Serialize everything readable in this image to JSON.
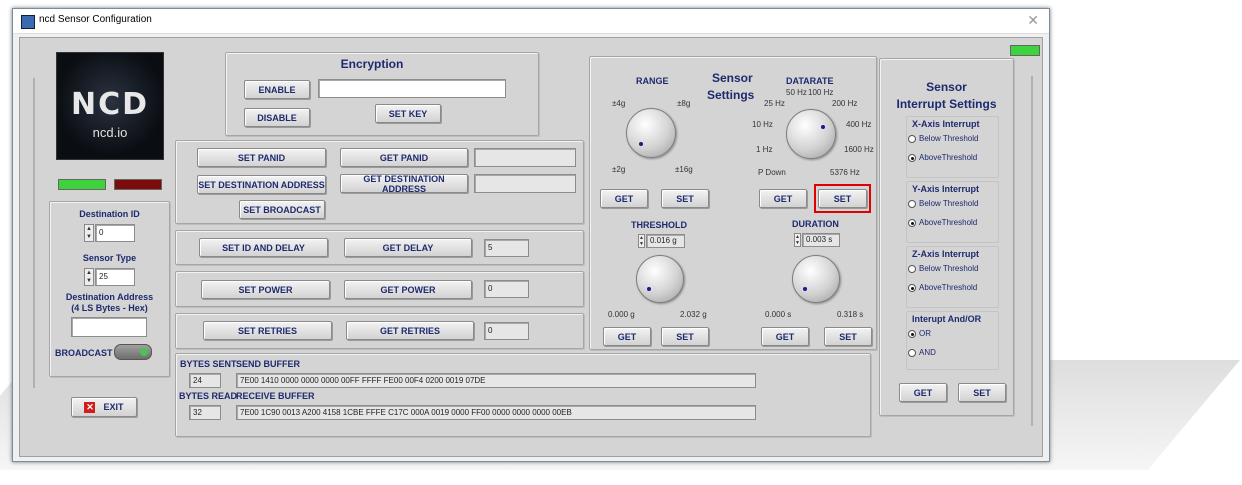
{
  "window": {
    "title": "ncd Sensor Configuration",
    "close_glyph": "✕"
  },
  "logo": {
    "big": "NCD",
    "site": "ncd.io"
  },
  "left": {
    "destination_id_label": "Destination ID",
    "destination_id_value": "0",
    "sensor_type_label": "Sensor Type",
    "sensor_type_value": "25",
    "dest_address_label_1": "Destination Address",
    "dest_address_label_2": "(4 LS Bytes - Hex)",
    "dest_address_value": "",
    "broadcast_label": "BROADCAST",
    "exit_label": "EXIT"
  },
  "encryption": {
    "title": "Encryption",
    "enable": "ENABLE",
    "disable": "DISABLE",
    "set_key": "SET KEY",
    "key_value": ""
  },
  "panid": {
    "set_panid": "SET PANID",
    "get_panid": "GET PANID",
    "panid_value": "",
    "set_dest": "SET DESTINATION ADDRESS",
    "get_dest": "GET DESTINATION ADDRESS",
    "dest_value": "",
    "set_broadcast": "SET BROADCAST"
  },
  "delay": {
    "set": "SET ID AND DELAY",
    "get": "GET DELAY",
    "value": "5"
  },
  "power": {
    "set": "SET POWER",
    "get": "GET POWER",
    "value": "0"
  },
  "retries": {
    "set": "SET RETRIES",
    "get": "GET RETRIES",
    "value": "0"
  },
  "buffers": {
    "bytes_sent_label": "BYTES SENT",
    "bytes_sent": "24",
    "send_label": "SEND BUFFER",
    "send_value": "7E00 1410 0000 0000 0000 00FF FFFF FE00 00F4 0200 0019 07DE",
    "bytes_read_label": "BYTES READ",
    "bytes_read": "32",
    "recv_label": "RECEIVE BUFFER",
    "recv_value": "7E00 1C90 0013 A200 4158 1CBE FFFE C17C 000A 0019 0000 FF00 0000 0000 0000 00EB"
  },
  "sensor": {
    "title_1": "Sensor",
    "title_2": "Settings",
    "range": {
      "label": "RANGE",
      "t1": "±4g",
      "t2": "±8g",
      "t3": "±2g",
      "t4": "±16g",
      "get": "GET",
      "set": "SET"
    },
    "datarate": {
      "label": "DATARATE",
      "labels": [
        "50 Hz",
        "100 Hz",
        "25 Hz",
        "200 Hz",
        "10 Hz",
        "400 Hz",
        "1 Hz",
        "1600 Hz",
        "P Down",
        "5376 Hz"
      ],
      "get": "GET",
      "set": "SET"
    },
    "threshold": {
      "label": "THRESHOLD",
      "value": "0.016 g",
      "min": "0.000 g",
      "max": "2.032 g",
      "get": "GET",
      "set": "SET"
    },
    "duration": {
      "label": "DURATION",
      "value": "0.003 s",
      "min": "0.000 s",
      "max": "0.318 s",
      "get": "GET",
      "set": "SET"
    }
  },
  "interrupt": {
    "title_1": "Sensor",
    "title_2": "Interrupt Settings",
    "x_label": "X-Axis Interrupt",
    "y_label": "Y-Axis Interrupt",
    "z_label": "Z-Axis Interrupt",
    "below": "Below Threshold",
    "above": "AboveThreshold",
    "andor_label": "Interupt And/OR",
    "or": "OR",
    "and": "AND",
    "get": "GET",
    "set": "SET"
  },
  "colors": {
    "led_green": "#3fd23f",
    "led_red": "#7a0c0c",
    "highlight": "#e00000",
    "label_blue": "#1e2a6e"
  }
}
